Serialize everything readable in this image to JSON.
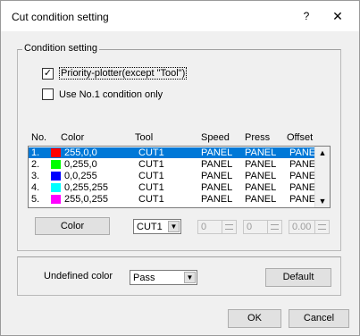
{
  "window": {
    "title": "Cut condition setting",
    "help": "?",
    "close": "✕"
  },
  "condition_group": {
    "label": "Condition setting",
    "priority_label": "Priority-plotter(except \"Tool\")",
    "priority_checked": "✓",
    "use_no1_label": "Use No.1 condition only"
  },
  "table": {
    "headers": [
      "No.",
      "Color",
      "Tool",
      "Speed",
      "Press",
      "Offset"
    ],
    "rows": [
      {
        "no": "1.",
        "color": "255,0,0",
        "swatch": "#ff0000",
        "tool": "CUT1",
        "speed": "PANEL",
        "press": "PANEL",
        "offset": "PANEL",
        "selected": true
      },
      {
        "no": "2.",
        "color": "0,255,0",
        "swatch": "#00ff00",
        "tool": "CUT1",
        "speed": "PANEL",
        "press": "PANEL",
        "offset": "PANEL",
        "selected": false
      },
      {
        "no": "3.",
        "color": "0,0,255",
        "swatch": "#0000ff",
        "tool": "CUT1",
        "speed": "PANEL",
        "press": "PANEL",
        "offset": "PANEL",
        "selected": false
      },
      {
        "no": "4.",
        "color": "0,255,255",
        "swatch": "#00ffff",
        "tool": "CUT1",
        "speed": "PANEL",
        "press": "PANEL",
        "offset": "PANEL",
        "selected": false
      },
      {
        "no": "5.",
        "color": "255,0,255",
        "swatch": "#ff00ff",
        "tool": "CUT1",
        "speed": "PANEL",
        "press": "PANEL",
        "offset": "PANEL",
        "selected": false
      }
    ]
  },
  "controls": {
    "color_button": "Color",
    "tool_value": "CUT1",
    "speed_value": "0",
    "press_value": "0",
    "offset_value": "0.00"
  },
  "undefined": {
    "label": "Undefined color",
    "value": "Pass",
    "default_button": "Default"
  },
  "footer": {
    "ok": "OK",
    "cancel": "Cancel"
  },
  "colors": {
    "selection": "#0078d7",
    "background": "#f0f0f0"
  }
}
